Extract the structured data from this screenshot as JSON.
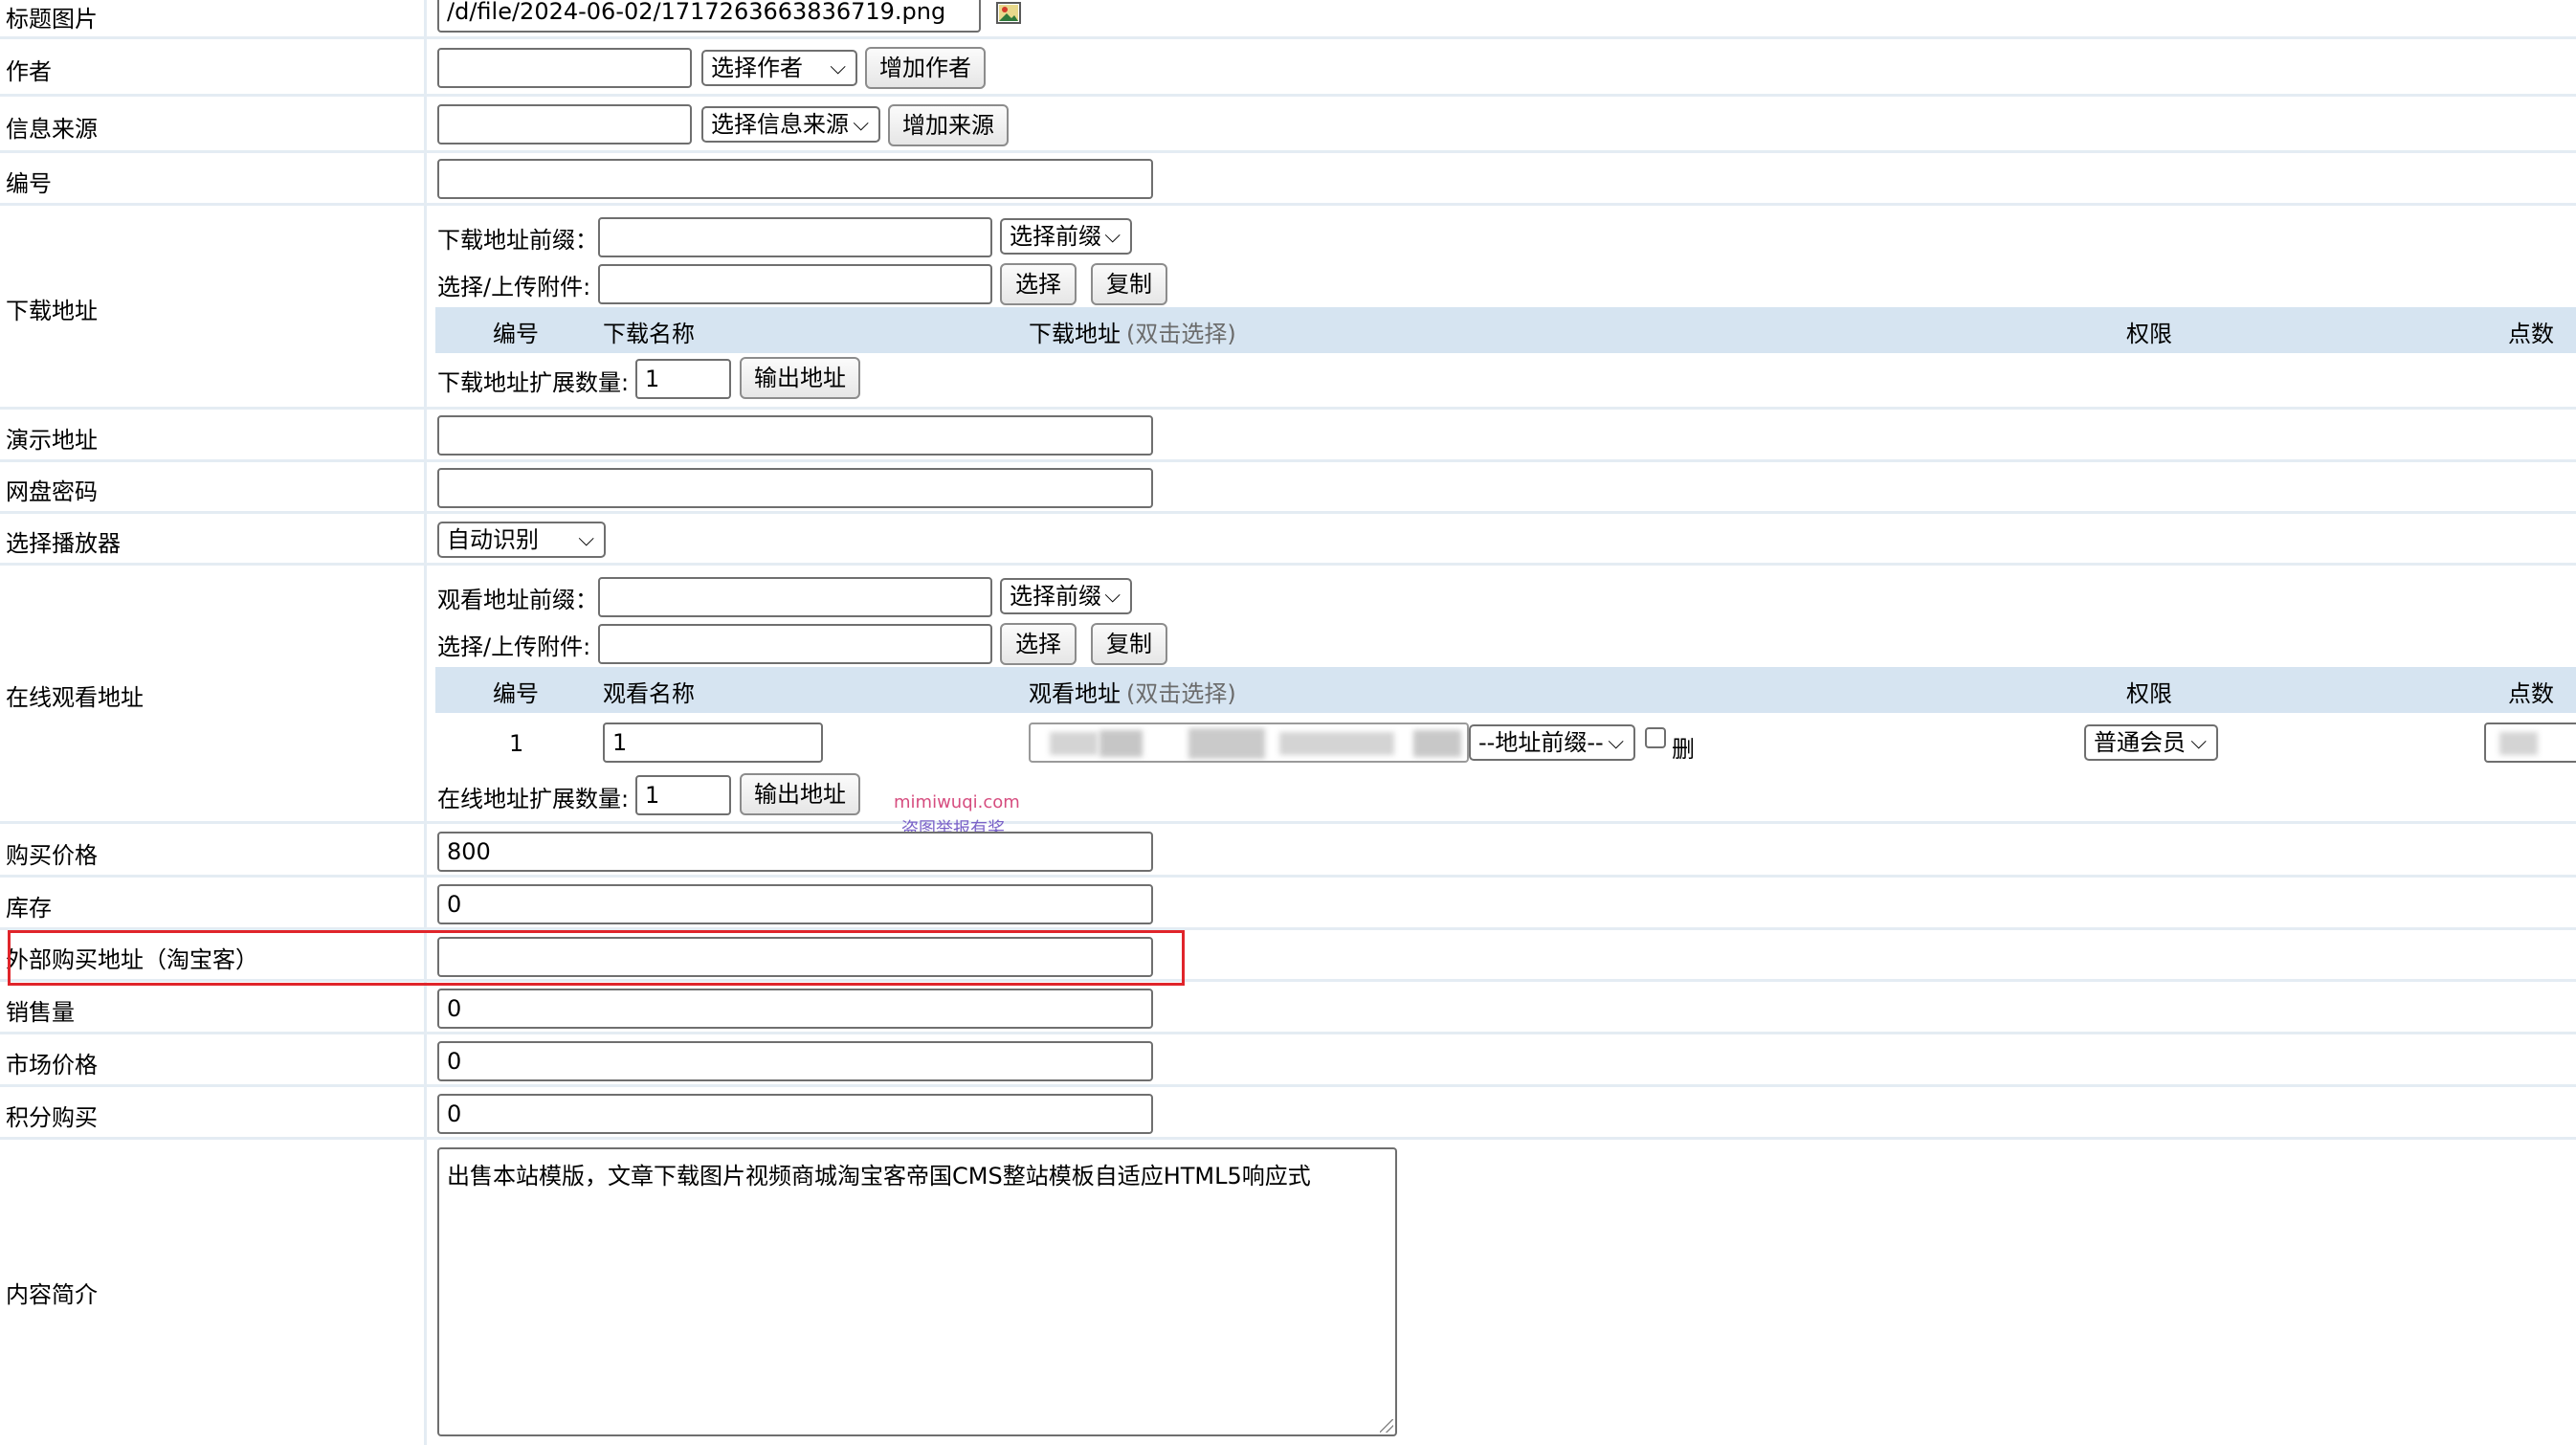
{
  "form": {
    "title_image": {
      "label": "标题图片",
      "value": "/d/file/2024-06-02/1717263663836719.png",
      "icon": "image-picker-icon"
    },
    "author": {
      "label": "作者",
      "value": "",
      "select": "选择作者",
      "button": "增加作者"
    },
    "source": {
      "label": "信息来源",
      "value": "",
      "select": "选择信息来源",
      "button": "增加来源"
    },
    "serial": {
      "label": "编号",
      "value": ""
    },
    "download": {
      "label": "下载地址",
      "prefix_label": "下载地址前缀：",
      "prefix_value": "",
      "prefix_select": "选择前缀",
      "upload_label": "选择/上传附件:",
      "upload_value": "",
      "choose_button": "选择",
      "copy_button": "复制",
      "col_no": "编号",
      "col_name": "下载名称",
      "col_url": "下载地址",
      "col_url_hint": "(双击选择)",
      "col_perm": "权限",
      "col_points": "点数",
      "ext_label": "下载地址扩展数量:",
      "ext_value": "1",
      "output_button": "输出地址"
    },
    "demo": {
      "label": "演示地址",
      "value": ""
    },
    "pan_password": {
      "label": "网盘密码",
      "value": ""
    },
    "player": {
      "label": "选择播放器",
      "select": "自动识别"
    },
    "online": {
      "label": "在线观看地址",
      "prefix_label": "观看地址前缀：",
      "prefix_value": "",
      "prefix_select": "选择前缀",
      "upload_label": "选择/上传附件:",
      "upload_value": "",
      "choose_button": "选择",
      "copy_button": "复制",
      "col_no": "编号",
      "col_name": "观看名称",
      "col_url": "观看地址",
      "col_url_hint": "(双击选择)",
      "col_perm": "权限",
      "col_points": "点数",
      "row_no": "1",
      "row_name": "1",
      "row_prefix_select": "--地址前缀--",
      "row_delete": "删",
      "row_perm": "普通会员",
      "ext_label": "在线地址扩展数量:",
      "ext_value": "1",
      "output_button": "输出地址"
    },
    "price": {
      "label": "购买价格",
      "value": "800"
    },
    "stock": {
      "label": "库存",
      "value": "0"
    },
    "external_buy": {
      "label": "外部购买地址（淘宝客）",
      "value": ""
    },
    "sales": {
      "label": "销售量",
      "value": "0"
    },
    "market_price": {
      "label": "市场价格",
      "value": "0"
    },
    "points_buy": {
      "label": "积分购买",
      "value": "0"
    },
    "summary": {
      "label": "内容简介",
      "value": "出售本站模版，文章下载图片视频商城淘宝客帝国CMS整站模板自适应HTML5响应式"
    }
  },
  "watermark": {
    "line1": "mimiwuqi.com",
    "line2": "盗图举报有奖"
  },
  "colors": {
    "highlight_border": "#e0252b",
    "table_header": "#d6e4f1",
    "row_divider": "#e4ecf3"
  }
}
